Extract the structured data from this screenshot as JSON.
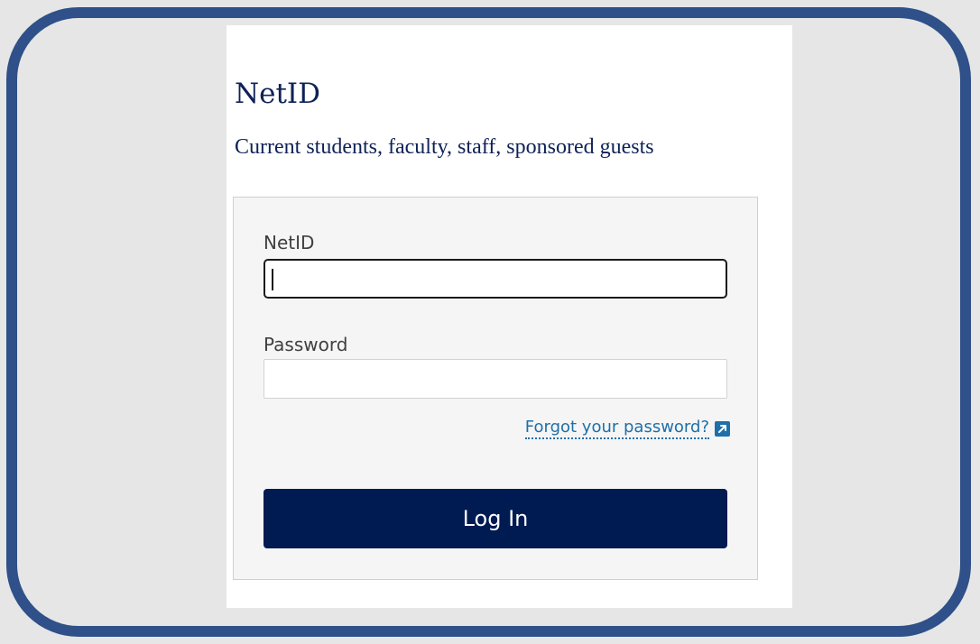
{
  "header": {
    "title": "NetID",
    "subtitle": "Current students, faculty, staff, sponsored guests"
  },
  "form": {
    "netid_label": "NetID",
    "netid_value": "",
    "password_label": "Password",
    "password_value": "",
    "forgot_link": "Forgot your password?",
    "login_button": "Log In"
  },
  "icons": {
    "forgot_link_icon": "external-link-icon"
  },
  "colors": {
    "frame_border": "#2f5089",
    "title_text": "#0f2257",
    "link": "#1f6fa8",
    "button_bg": "#001a52"
  }
}
